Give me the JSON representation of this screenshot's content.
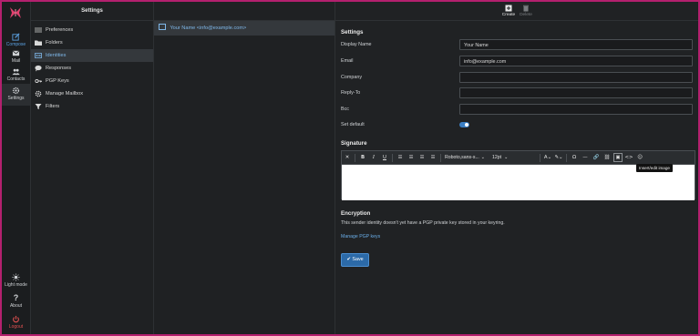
{
  "rail": {
    "compose": "Compose",
    "mail": "Mail",
    "contacts": "Contacts",
    "settings": "Settings",
    "light_mode": "Light mode",
    "about": "About",
    "logout": "Logout"
  },
  "nav": {
    "title": "Settings",
    "items": [
      {
        "label": "Preferences",
        "icon": "sliders-icon"
      },
      {
        "label": "Folders",
        "icon": "folder-icon"
      },
      {
        "label": "Identities",
        "icon": "id-card-icon"
      },
      {
        "label": "Responses",
        "icon": "chat-bubble-icon"
      },
      {
        "label": "PGP Keys",
        "icon": "key-icon"
      },
      {
        "label": "Manage Mailbox",
        "icon": "gear-icon"
      },
      {
        "label": "Filters",
        "icon": "filter-icon"
      }
    ]
  },
  "identity_list": {
    "items": [
      "Your Name <info@example.com>"
    ]
  },
  "toolbar": {
    "create": "Create",
    "delete": "Delete"
  },
  "settings": {
    "title": "Settings",
    "display_name_label": "Display Name",
    "display_name_value": "Your Name",
    "email_label": "Email",
    "email_value": "info@example.com",
    "company_label": "Company",
    "reply_to_label": "Reply-To",
    "bcc_label": "Bcc",
    "set_default_label": "Set default",
    "set_default_on": true
  },
  "signature": {
    "title": "Signature",
    "font_family": "Roboto,sans-s...",
    "font_size": "12pt",
    "tooltip": "Insert/edit image"
  },
  "encryption": {
    "title": "Encryption",
    "text": "This sender identity doesn't yet have a PGP private key stored in your keyring.",
    "manage_link": "Manage PGP keys"
  },
  "save_label": "Save",
  "colors": {
    "accent": "#3b7fc4",
    "link": "#6aaee8",
    "frame": "#b3206e",
    "logout": "#e05050"
  }
}
